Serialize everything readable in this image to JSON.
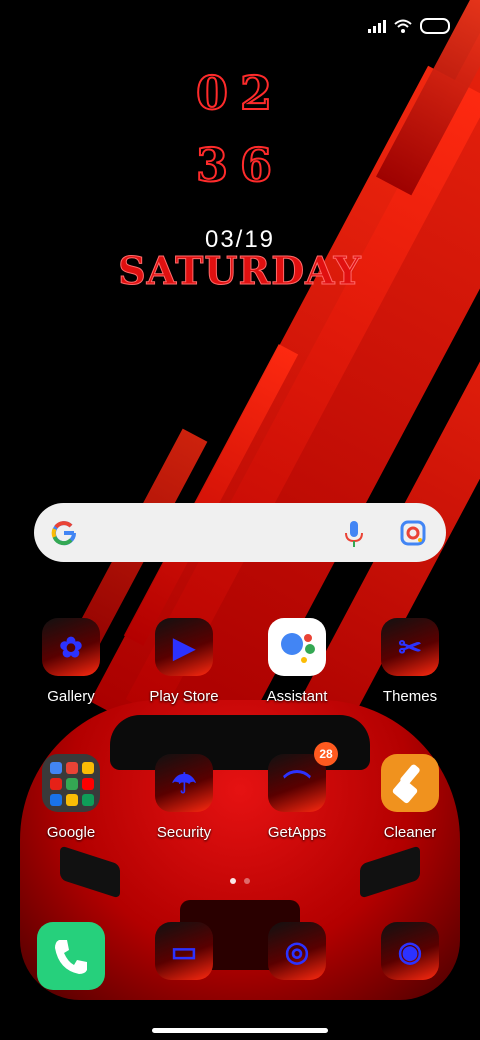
{
  "status_bar": {
    "icons": [
      "signal-icon",
      "wifi-icon",
      "battery-icon"
    ]
  },
  "clock": {
    "hour": "02",
    "minute": "36",
    "date": "03/19",
    "day": "SATURDAY"
  },
  "search_bar": {
    "icons": [
      "google-g-icon",
      "microphone-icon",
      "google-lens-icon"
    ]
  },
  "apps_row1": [
    {
      "label": "Gallery",
      "icon": "gallery-icon"
    },
    {
      "label": "Play Store",
      "icon": "play-store-icon"
    },
    {
      "label": "Assistant",
      "icon": "assistant-icon"
    },
    {
      "label": "Themes",
      "icon": "themes-icon"
    }
  ],
  "apps_row2": [
    {
      "label": "Google",
      "icon": "google-folder-icon"
    },
    {
      "label": "Security",
      "icon": "security-icon"
    },
    {
      "label": "GetApps",
      "icon": "getapps-icon",
      "badge": "28"
    },
    {
      "label": "Cleaner",
      "icon": "cleaner-icon"
    }
  ],
  "dock": [
    {
      "icon": "phone-icon"
    },
    {
      "icon": "messages-icon"
    },
    {
      "icon": "browser-icon"
    },
    {
      "icon": "camera-icon"
    }
  ],
  "page_indicator": {
    "pages": 2,
    "current": 1
  },
  "colors": {
    "accent_red": "#e01010",
    "glyph_blue": "#2c32ff",
    "badge_orange": "#ff5a1f",
    "phone_green": "#26d07c",
    "cleaner_orange": "#f0921e"
  }
}
